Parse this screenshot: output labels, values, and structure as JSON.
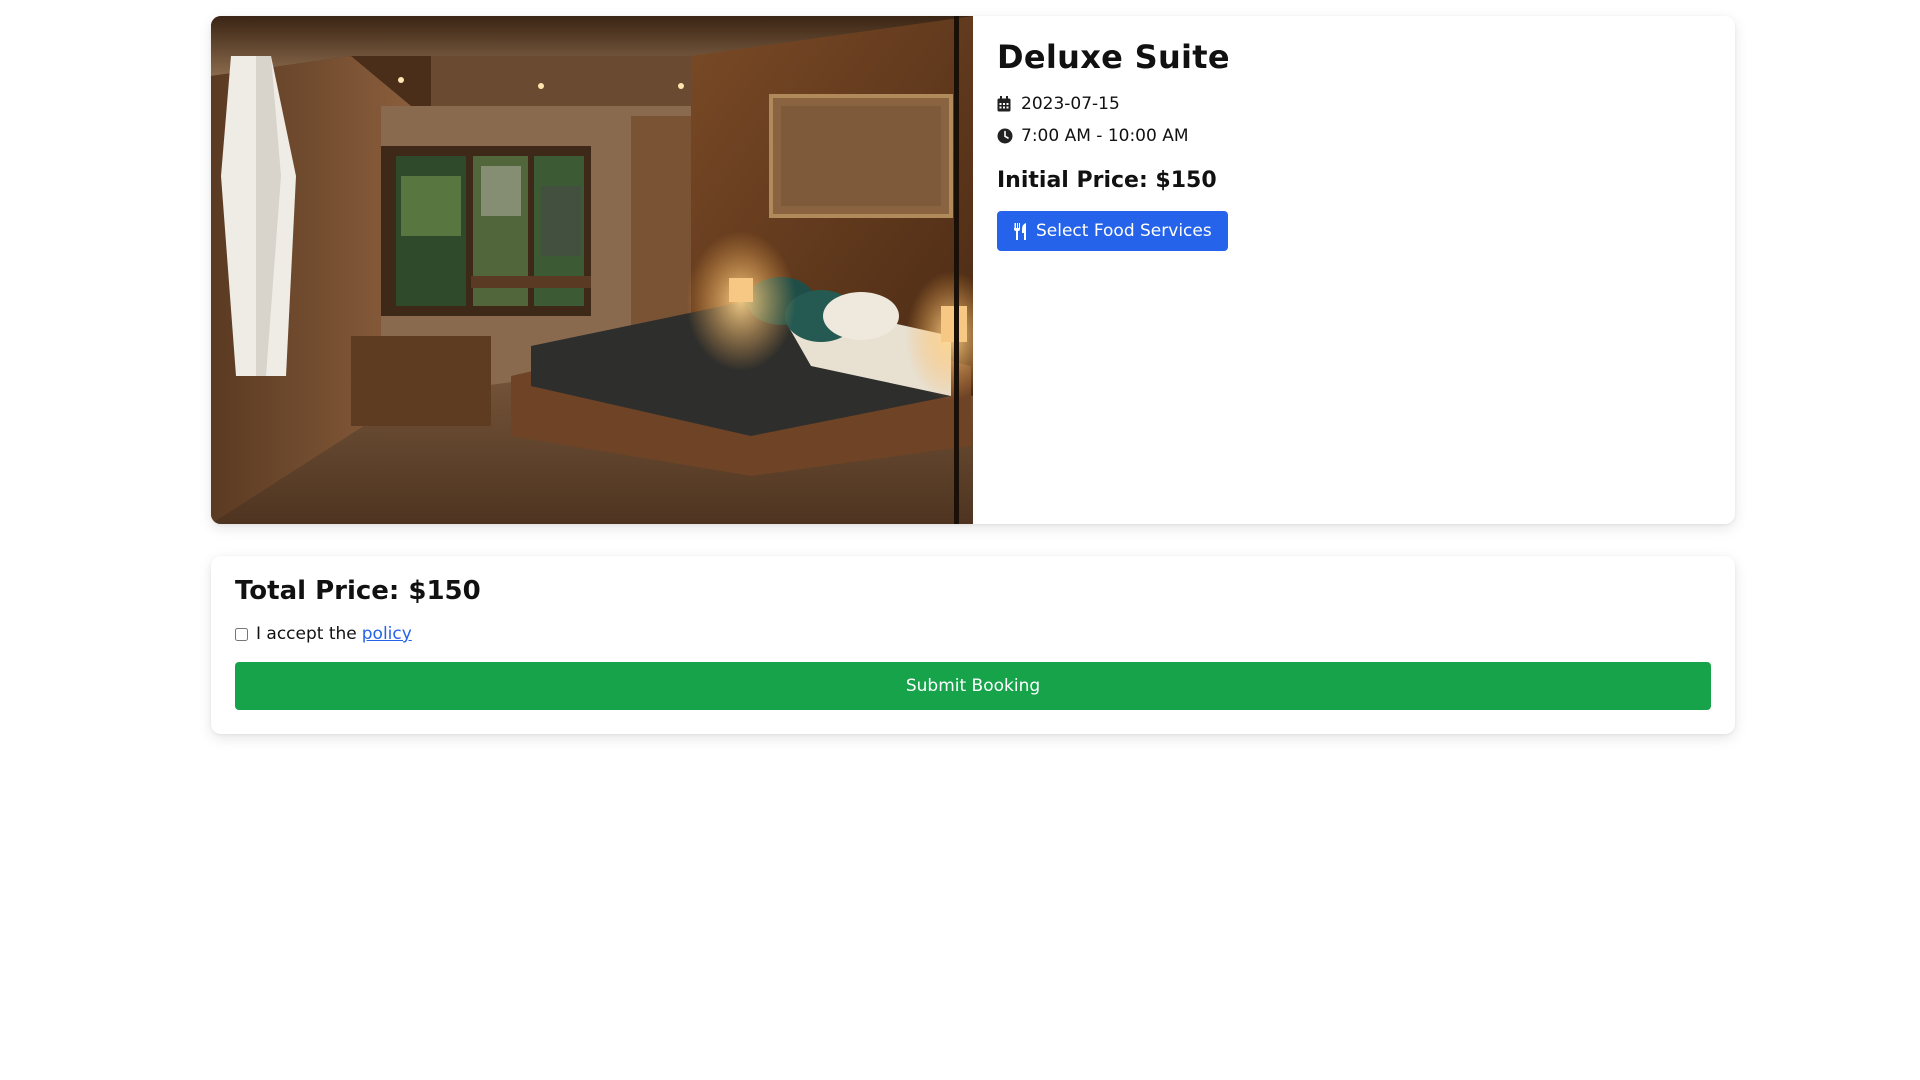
{
  "room": {
    "title": "Deluxe Suite",
    "date": "2023-07-15",
    "time": "7:00 AM - 10:00 AM",
    "initial_price": "Initial Price: $150",
    "food_button_label": "Select Food Services",
    "photo_icon": "hotel-room-photo"
  },
  "summary": {
    "total_price": "Total Price: $150",
    "policy_text": "I accept the",
    "policy_link": "policy",
    "policy_checked": false,
    "submit_label": "Submit Booking"
  },
  "icons": {
    "date": "calendar-icon",
    "time": "clock-icon",
    "food": "utensils-icon"
  },
  "colors": {
    "primary_button": "#2563eb",
    "submit_button": "#16a34a",
    "link": "#2563eb"
  }
}
